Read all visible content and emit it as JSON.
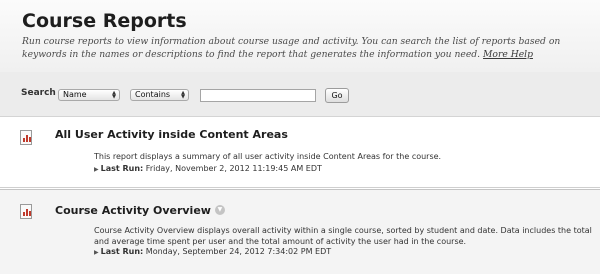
{
  "page": {
    "title": "Course Reports",
    "description": "Run course reports to view information about course usage and activity. You can search the list of reports based on keywords in the names or descriptions to find the report that generates the information you need.",
    "help_link": "More Help"
  },
  "search": {
    "label": "Search",
    "field_select": "Name",
    "operator_select": "Contains",
    "input_value": "",
    "go_label": "Go"
  },
  "reports": [
    {
      "name": "All User Activity inside Content Areas",
      "description": "This report displays a summary of all user activity inside Content Areas for the course.",
      "last_run_label": "Last Run:",
      "last_run_value": "Friday, November 2, 2012 11:19:45 AM EDT"
    },
    {
      "name": "Course Activity Overview",
      "description": "Course Activity Overview displays overall activity within a single course, sorted by student and date. Data includes the total and average time spent per user and the total amount of activity the user had in the course.",
      "last_run_label": "Last Run:",
      "last_run_value": "Monday, September 24, 2012 7:34:02 PM EDT"
    }
  ],
  "icons": {
    "report_icon": "report-chart-icon",
    "options_icon": "chevron-down-icon",
    "expand_icon": "triangle-right-icon"
  },
  "colors": {
    "header_bg": "#f0f0f0",
    "searchbar_bg": "#ececec",
    "report_icon_bar": "#c0392b"
  }
}
